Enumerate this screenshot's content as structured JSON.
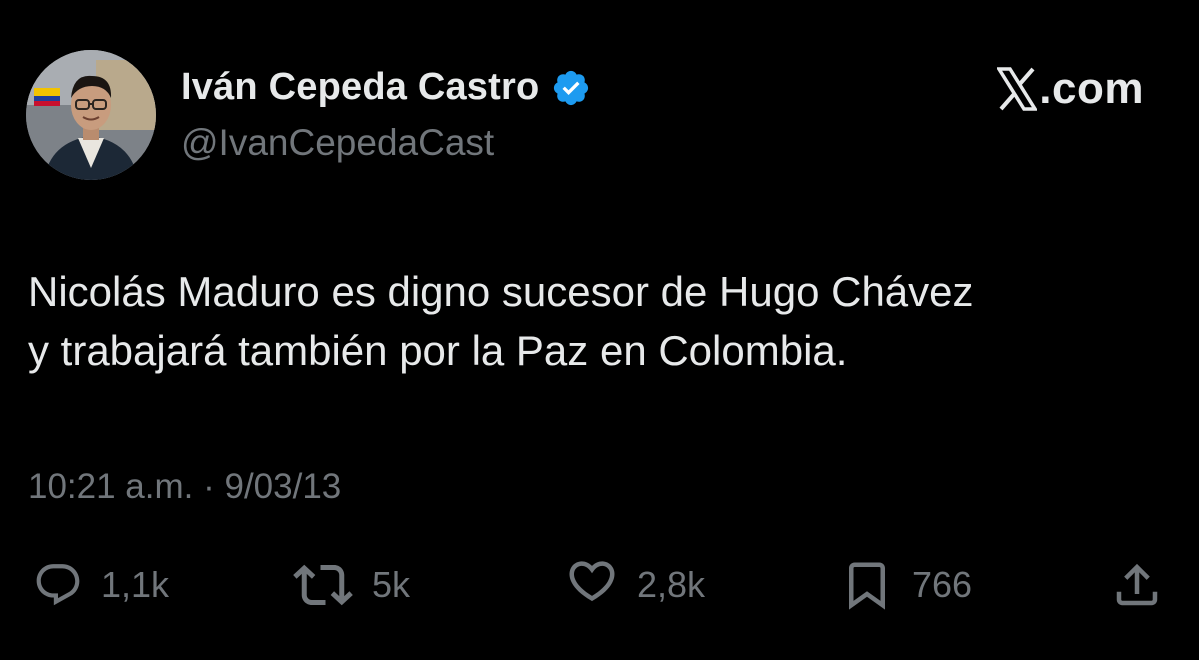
{
  "author": {
    "name": "Iván Cepeda Castro",
    "handle": "@IvanCepedaCast",
    "verified": true
  },
  "brand": {
    "text": ".com",
    "icon": "x-logo-icon"
  },
  "tweet": {
    "lines": [
      "Nicolás Maduro es digno sucesor de Hugo Chávez",
      "y trabajará también por la Paz en Colombia."
    ],
    "timestamp": "10:21 a.m. · 9/03/13"
  },
  "actions": {
    "reply": {
      "icon": "reply-icon",
      "count": "1,1k"
    },
    "repost": {
      "icon": "repost-icon",
      "count": "5k"
    },
    "like": {
      "icon": "heart-icon",
      "count": "2,8k"
    },
    "bookmark": {
      "icon": "bookmark-icon",
      "count": "766"
    },
    "share": {
      "icon": "share-icon"
    }
  },
  "colors": {
    "background": "#000000",
    "primary_text": "#e7e9ea",
    "secondary_text": "#71767b",
    "verified_badge": "#1d9bf0"
  }
}
